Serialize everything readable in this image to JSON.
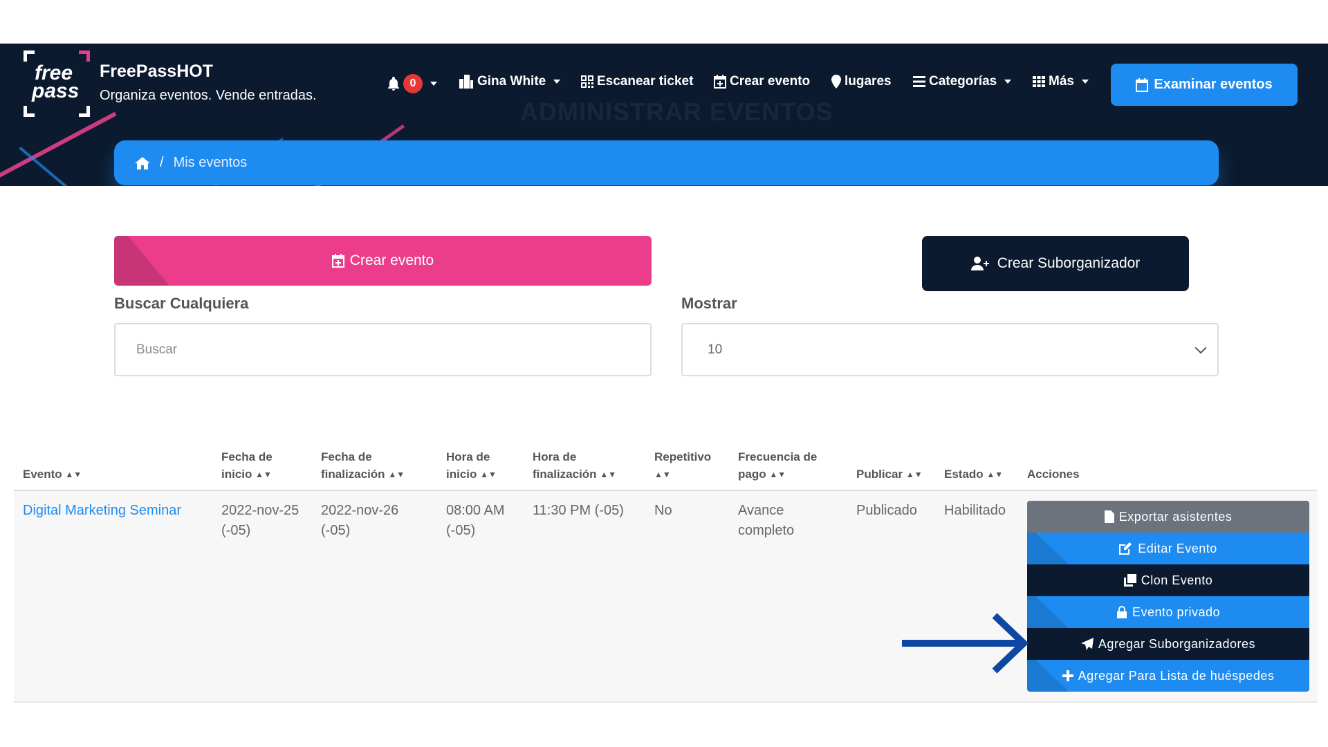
{
  "brand": {
    "logo_line1": "free",
    "logo_line2": "pass",
    "title": "FreePassHOT",
    "subtitle": "Organiza eventos. Vende entradas."
  },
  "header": {
    "ghost_title": "ADMINISTRAR EVENTOS",
    "notifications_count": "0",
    "user_name": "Gina White",
    "scan_label": "Escanear ticket",
    "create_label": "Crear evento",
    "places_label": "lugares",
    "categories_label": "Categorías",
    "more_label": "Más",
    "browse_label": "Examinar eventos"
  },
  "breadcrumb": {
    "separator": "/",
    "current": "Mis eventos"
  },
  "actions": {
    "create_event": "Crear evento",
    "create_suborganizer": "Crear Suborganizador"
  },
  "filters": {
    "search_label": "Buscar Cualquiera",
    "search_placeholder": "Buscar",
    "show_label": "Mostrar",
    "show_value": "10"
  },
  "table": {
    "headers": {
      "evento": "Evento",
      "fecha_inicio_1": "Fecha de",
      "fecha_inicio_2": "inicio",
      "fecha_fin_1": "Fecha de",
      "fecha_fin_2": "finalización",
      "hora_inicio_1": "Hora de",
      "hora_inicio_2": "inicio",
      "hora_fin_1": "Hora de",
      "hora_fin_2": "finalización",
      "repetitivo": "Repetitivo",
      "frecuencia_1": "Frecuencia de",
      "frecuencia_2": "pago",
      "publicar": "Publicar",
      "estado": "Estado",
      "acciones": "Acciones"
    },
    "row": {
      "evento": "Digital Marketing Seminar",
      "fecha_inicio_1": "2022-nov-25",
      "fecha_inicio_2": "(-05)",
      "fecha_fin_1": "2022-nov-26",
      "fecha_fin_2": "(-05)",
      "hora_inicio_1": "08:00 AM",
      "hora_inicio_2": "(-05)",
      "hora_fin": "11:30 PM (-05)",
      "repetitivo": "No",
      "frecuencia_1": "Avance",
      "frecuencia_2": "completo",
      "publicar": "Publicado",
      "estado": "Habilitado"
    },
    "row_actions": {
      "export": "Exportar asistentes",
      "edit": "Editar Evento",
      "clone": "Clon Evento",
      "private": "Evento privado",
      "add_suborganizers": "Agregar Suborganizadores",
      "add_guestlist": "Agregar Para Lista de huéspedes"
    }
  },
  "colors": {
    "navy": "#0b1a2e",
    "blue": "#1e8bf0",
    "pink": "#ec3d8c",
    "gray": "#6c737c",
    "arrow": "#0d47a1"
  }
}
